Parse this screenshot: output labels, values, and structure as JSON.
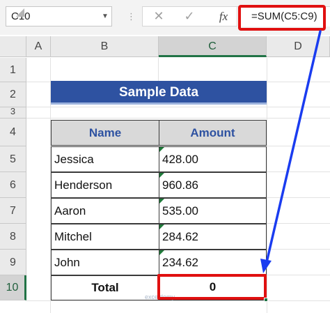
{
  "formula_bar": {
    "name_box": "C10",
    "formula": "=SUM(C5:C9)",
    "dots": "⋮",
    "cancel_icon": "✕",
    "enter_icon": "✓",
    "fx_label": "fx"
  },
  "columns": [
    "A",
    "B",
    "C",
    "D"
  ],
  "rows": [
    "1",
    "2",
    "3",
    "4",
    "5",
    "6",
    "7",
    "8",
    "9",
    "10"
  ],
  "title": "Sample Data",
  "table": {
    "headers": [
      "Name",
      "Amount"
    ],
    "rows": [
      {
        "name": "Jessica",
        "amount": "428.00"
      },
      {
        "name": "Henderson",
        "amount": "960.86"
      },
      {
        "name": "Aaron",
        "amount": "535.00"
      },
      {
        "name": "Mitchel",
        "amount": "284.62"
      },
      {
        "name": "John",
        "amount": "234.62"
      }
    ],
    "total_label": "Total",
    "total_value": "0"
  },
  "watermark": "exceldemy",
  "colors": {
    "title_bg": "#2e52a1",
    "highlight": "#e01010",
    "arrow": "#1a3cf0",
    "selection": "#217346"
  }
}
